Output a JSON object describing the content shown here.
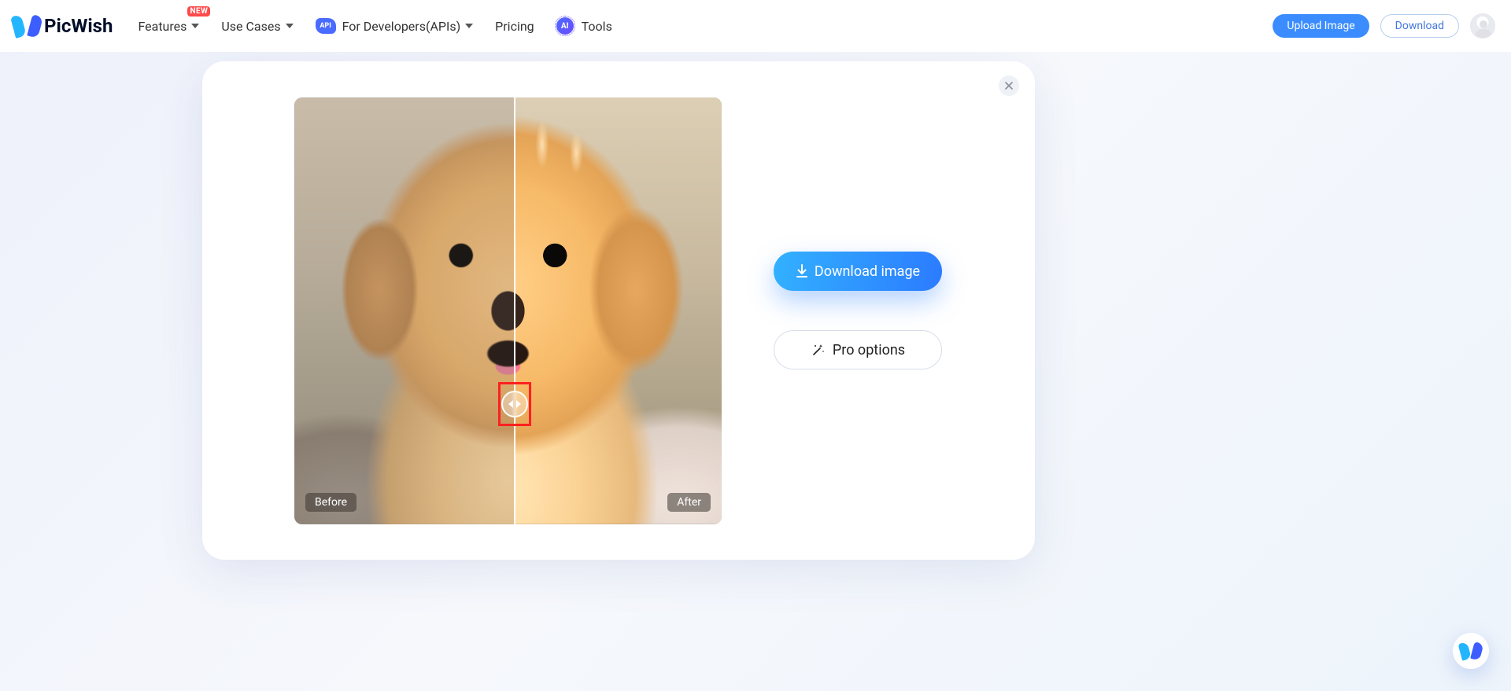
{
  "brand": {
    "name": "PicWish"
  },
  "nav": {
    "features": "Features",
    "features_badge": "NEW",
    "use_cases": "Use Cases",
    "developers": "For Developers(APIs)",
    "pricing": "Pricing",
    "tools": "Tools",
    "api_badge": "API",
    "ai_badge": "AI"
  },
  "header_actions": {
    "upload": "Upload Image",
    "download": "Download"
  },
  "panel": {
    "before_label": "Before",
    "after_label": "After",
    "download_image": "Download image",
    "pro_options": "Pro options"
  }
}
